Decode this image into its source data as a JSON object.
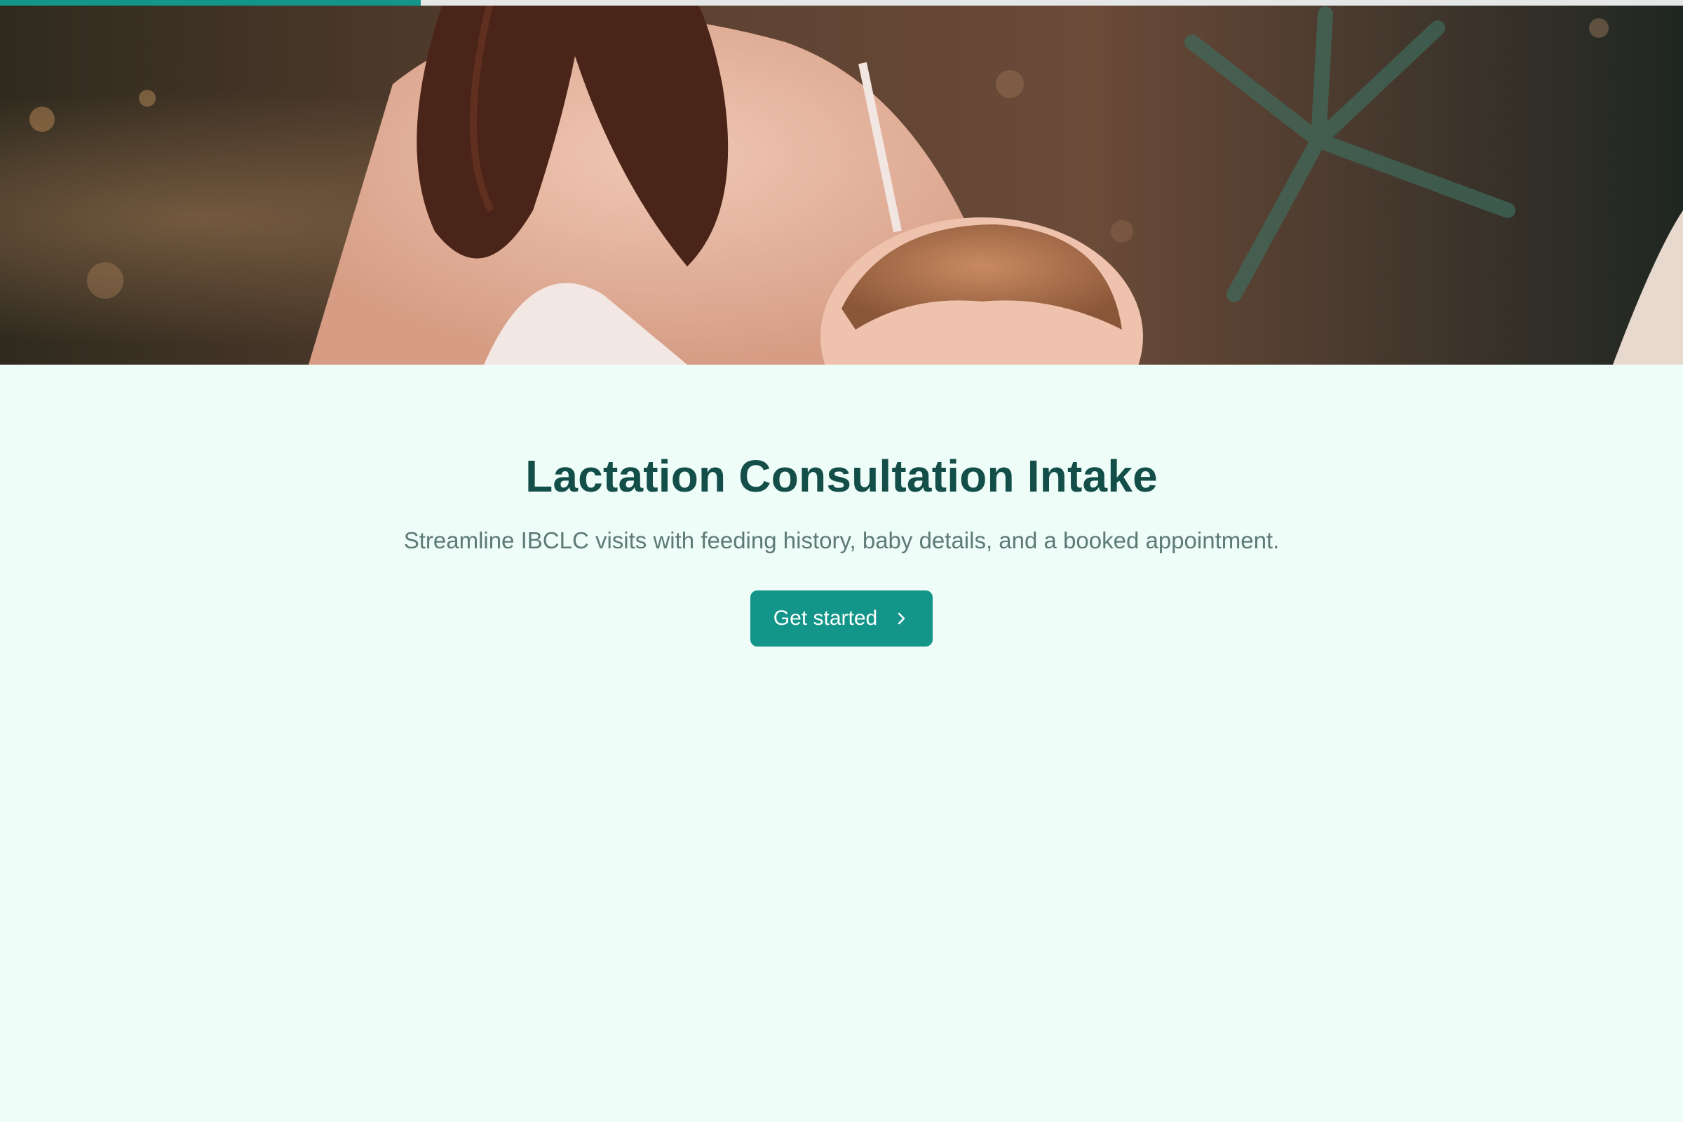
{
  "progress": {
    "value": 0.25,
    "color": "#13958a"
  },
  "hero": {
    "image_alt": "Mother breastfeeding a baby outdoors"
  },
  "intake": {
    "title": "Lactation Consultation Intake",
    "subtitle": "Streamline IBCLC visits with feeding history, baby details, and a booked appointment.",
    "cta_label": "Get started",
    "cta_icon": "chevron-right-icon"
  },
  "colors": {
    "background": "#effdf9",
    "title": "#134e48",
    "subtitle": "#5d7a76",
    "accent": "#13958a"
  }
}
